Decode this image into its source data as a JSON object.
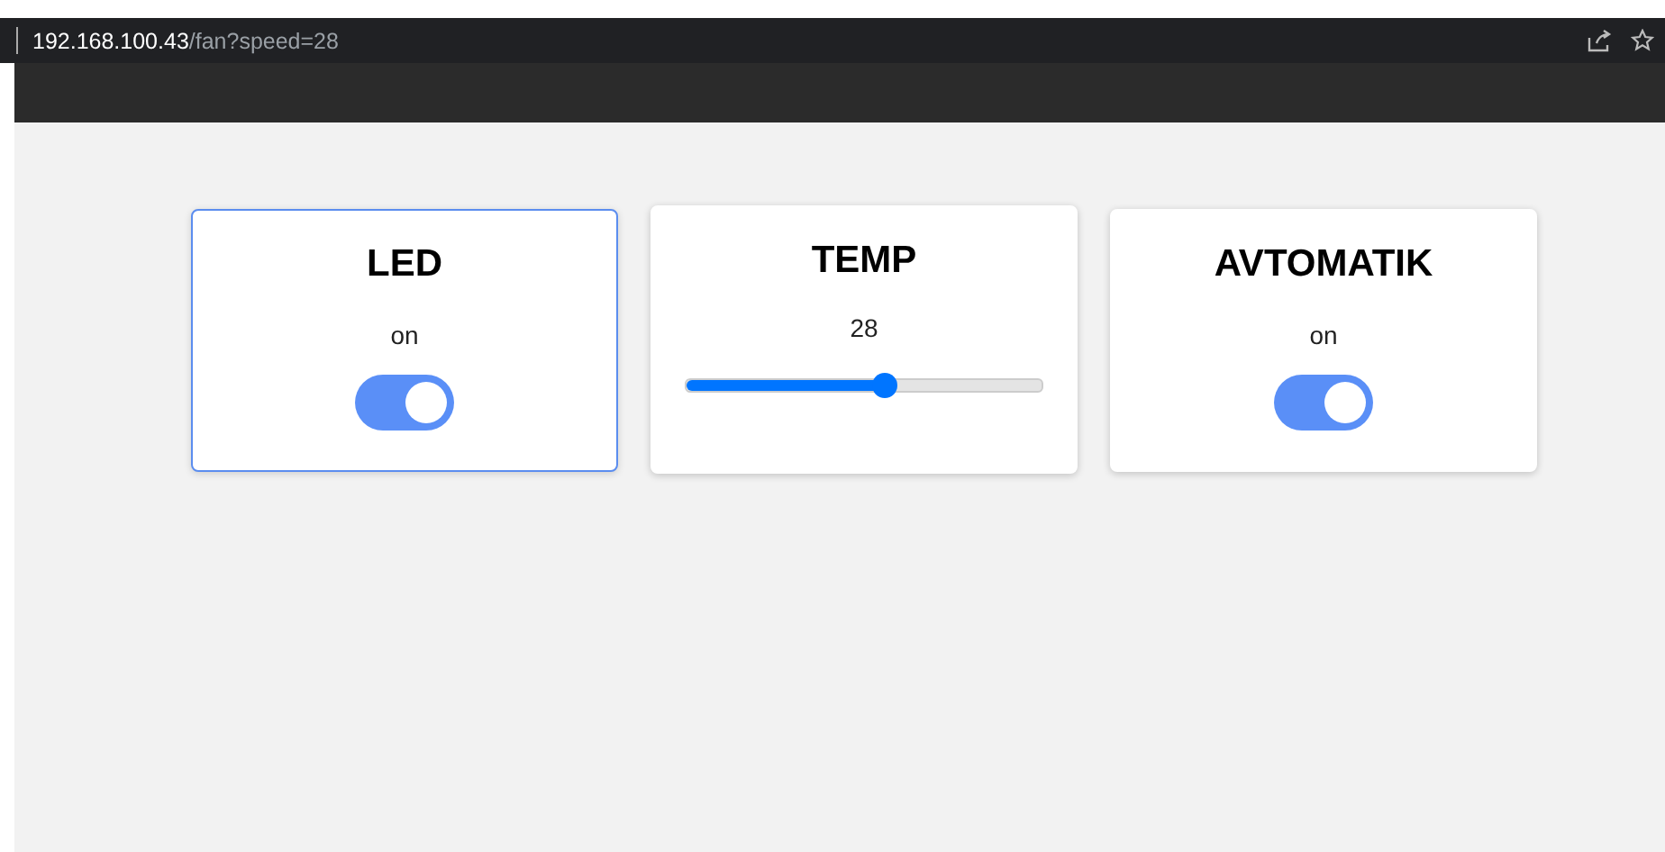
{
  "address_bar": {
    "host": "192.168.100.43",
    "path": "/fan?speed=28"
  },
  "cards": [
    {
      "kind": "toggle",
      "title": "LED",
      "status": "on",
      "on": true,
      "focused": true
    },
    {
      "kind": "slider",
      "title": "TEMP",
      "value": "28",
      "level": 0.56,
      "focused": false
    },
    {
      "kind": "toggle",
      "title": "AVTOMATIK",
      "status": "on",
      "on": true,
      "focused": false
    }
  ]
}
